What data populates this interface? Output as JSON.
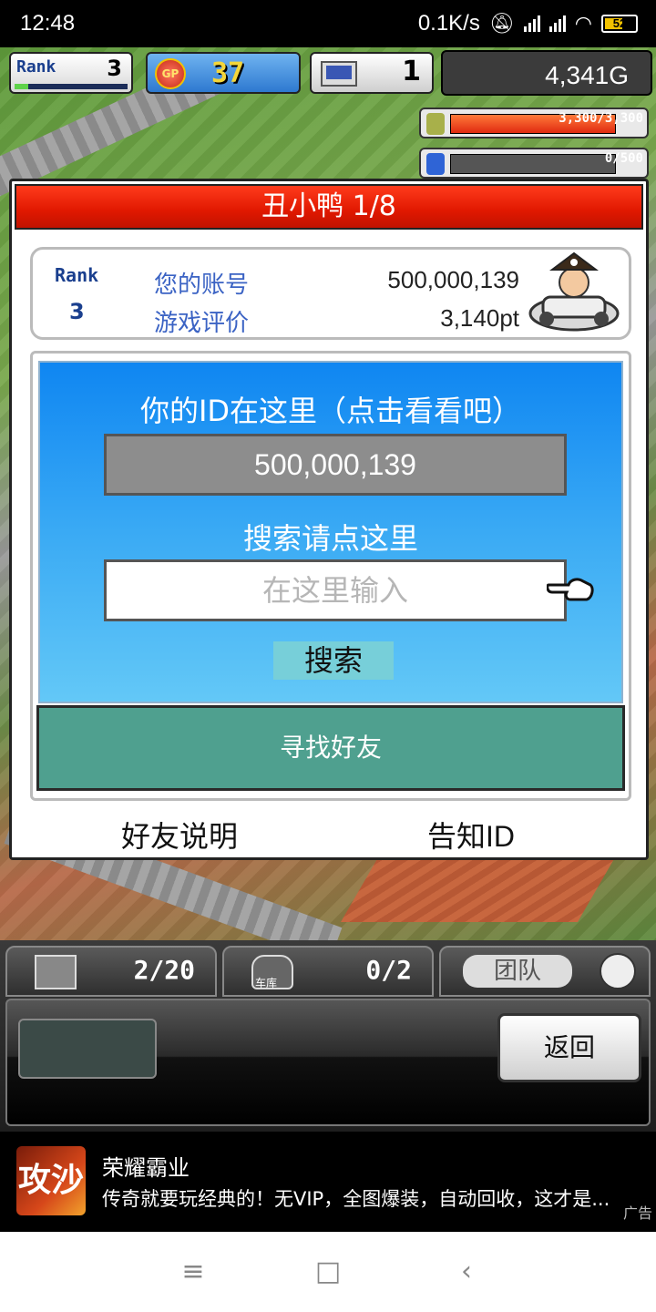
{
  "status_bar": {
    "time": "12:48",
    "speed": "0.1K/s",
    "battery": "52"
  },
  "hud": {
    "rank_label": "Rank",
    "rank_value": "3",
    "rank_progress": 0.12,
    "gp_icon_label": "GP",
    "gp_value": "37",
    "computer_value": "1",
    "money": "4,341G",
    "resource1": "3,300/3,300",
    "resource2": "0/500"
  },
  "dialog": {
    "title": "丑小鸭 1/8",
    "account": {
      "rank_label": "Rank",
      "rank_value": "3",
      "account_label": "您的账号",
      "account_value": "500,000,139",
      "rating_label": "游戏评价",
      "rating_value": "3,140pt"
    },
    "id_header": "你的ID在这里（点击看看吧）",
    "id_value": "500,000,139",
    "search_header": "搜索请点这里",
    "search_placeholder": "在这里输入",
    "search_button": "搜索",
    "find_friends": "寻找好友",
    "friend_help": "好友说明",
    "share_id": "告知ID"
  },
  "bottom": {
    "tab1_count": "2/20",
    "tab2_caption": "车库",
    "tab2_count": "0/2",
    "tab3_label": "团队",
    "back_button": "返回"
  },
  "ad": {
    "logo_text": "攻沙",
    "title": "荣耀霸业",
    "text": "传奇就要玩经典的！无VIP，全图爆装，自动回收，这才是...",
    "tag": "广告"
  },
  "nav": {
    "menu": "≡",
    "home": "□",
    "back": "‹"
  },
  "colors": {
    "title_red": "#e01800",
    "panel_blue": "#0f86f2",
    "find_green": "#4fa08f",
    "search_btn": "#77cfd9"
  }
}
